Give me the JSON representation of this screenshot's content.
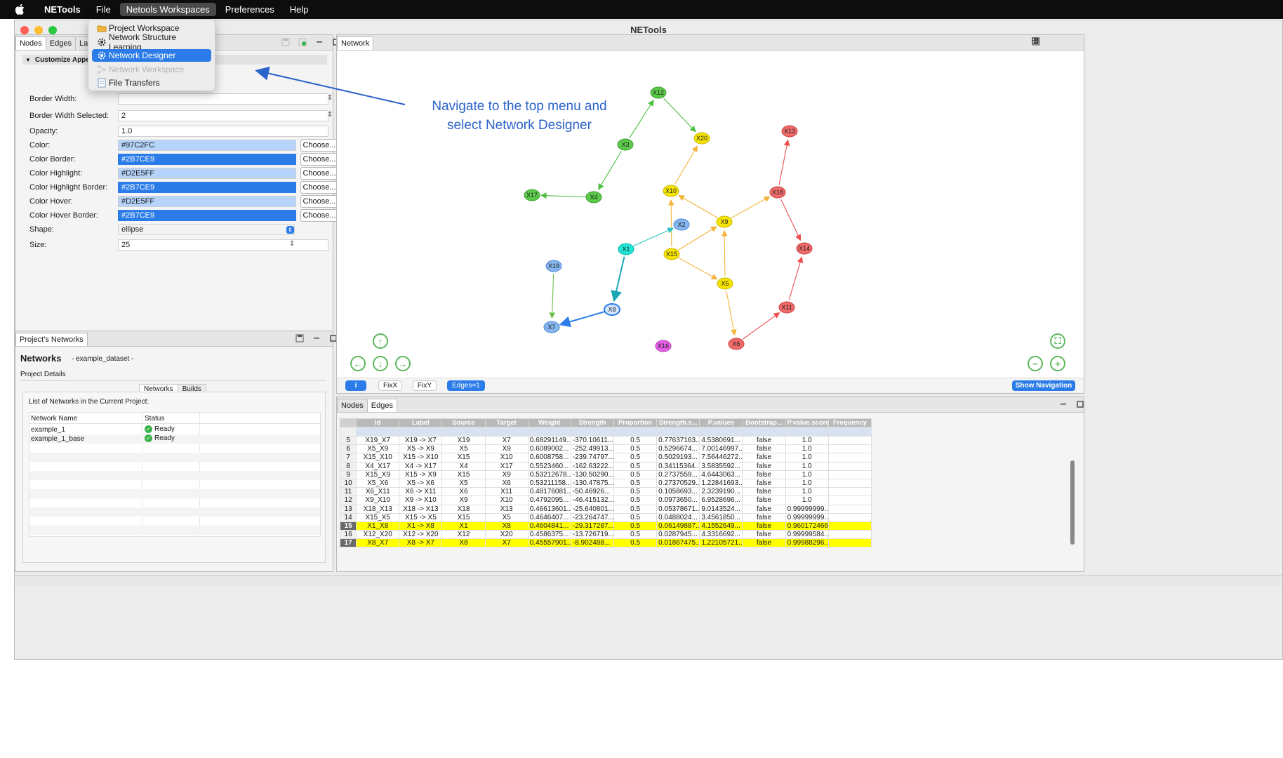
{
  "menubar": {
    "app": "NETools",
    "items": [
      "File",
      "Netools Workspaces",
      "Preferences",
      "Help"
    ]
  },
  "window": {
    "title": "NETools"
  },
  "left_tabs": [
    "Nodes",
    "Edges",
    "Layout"
  ],
  "customize": {
    "header": "Customize Appea",
    "fields": [
      {
        "label": "Border Width:",
        "value": ""
      },
      {
        "label": "Border Width Selected:",
        "value": "2"
      },
      {
        "label": "Opacity:",
        "value": "1.0"
      },
      {
        "label": "Color:",
        "value": "#97C2FC"
      },
      {
        "label": "Color Border:",
        "value": "#2B7CE9"
      },
      {
        "label": "Color Highlight:",
        "value": "#D2E5FF"
      },
      {
        "label": "Color Highlight Border:",
        "value": "#2B7CE9"
      },
      {
        "label": "Color Hover:",
        "value": "#D2E5FF"
      },
      {
        "label": "Color Hover Border:",
        "value": "#2B7CE9"
      },
      {
        "label": "Shape:",
        "value": "ellipse"
      },
      {
        "label": "Size:",
        "value": "25"
      }
    ],
    "choose_label": "Choose..."
  },
  "dropdown": {
    "items": [
      {
        "label": "Project Workspace",
        "icon": "folder-icon",
        "state": "normal"
      },
      {
        "label": "Network Structure Learning",
        "icon": "gear-icon",
        "state": "normal"
      },
      {
        "label": "Network Designer",
        "icon": "gear-icon",
        "state": "highlighted"
      },
      {
        "label": "Network Workspace",
        "icon": "network-icon",
        "state": "disabled"
      },
      {
        "label": "File Transfers",
        "icon": "file-icon",
        "state": "normal"
      }
    ]
  },
  "annotation": {
    "line1": "Navigate to the top menu and",
    "line2": "select Network Designer"
  },
  "project": {
    "tab": "Project's Networks",
    "title": "Networks",
    "dataset": "- example_dataset -",
    "details": "Project Details",
    "subtabs": [
      "Networks",
      "Builds"
    ],
    "list_caption": "List of Networks in the Current Project:",
    "col_name": "Network Name",
    "col_status": "Status",
    "rows": [
      {
        "name": "example_1",
        "status": "Ready"
      },
      {
        "name": "example_1_base",
        "status": "Ready"
      }
    ]
  },
  "network_panel": {
    "tab": "Network"
  },
  "graph": {
    "nodes": [
      {
        "id": "X12",
        "color": "#5cc94b"
      },
      {
        "id": "X20",
        "color": "#f5e400"
      },
      {
        "id": "X3",
        "color": "#5cc94b"
      },
      {
        "id": "X13",
        "color": "#f06a6a"
      },
      {
        "id": "X17",
        "color": "#5cc94b"
      },
      {
        "id": "X4",
        "color": "#5cc94b"
      },
      {
        "id": "X10",
        "color": "#f5e400"
      },
      {
        "id": "X18",
        "color": "#f06a6a"
      },
      {
        "id": "X2",
        "color": "#86b6ef"
      },
      {
        "id": "X9",
        "color": "#f5e400"
      },
      {
        "id": "X1",
        "color": "#1fe6d6"
      },
      {
        "id": "X15",
        "color": "#f5e400"
      },
      {
        "id": "X14",
        "color": "#f06a6a"
      },
      {
        "id": "X19",
        "color": "#86b6ef"
      },
      {
        "id": "X5",
        "color": "#f5e400"
      },
      {
        "id": "X8",
        "color": "#d2e5ff"
      },
      {
        "id": "X11",
        "color": "#f06a6a"
      },
      {
        "id": "X7",
        "color": "#86b6ef"
      },
      {
        "id": "X16",
        "color": "#e65de6"
      },
      {
        "id": "X6",
        "color": "#f06a6a"
      }
    ]
  },
  "graph_toolbar": {
    "info": "i",
    "fixx": "FixX",
    "fixy": "FixY",
    "edges_btn": "Edges=1",
    "show_nav": "Show Navigation"
  },
  "bottom_tabs": [
    "Nodes",
    "Edges"
  ],
  "edges_table": {
    "headers": [
      "Id",
      "Label",
      "Source",
      "Target",
      "Weight",
      "Strength",
      "Proportion",
      "Strength.s...",
      "P.values",
      "Bootstrap...",
      "P.value.score",
      "Frequency"
    ],
    "rows": [
      {
        "n": "5",
        "cells": [
          "X19_X7",
          "X19 -> X7",
          "X19",
          "X7",
          "0.68291149...",
          "-370.10611...",
          "0.5",
          "0.77637163...",
          "4.5380691...",
          "false",
          "1.0",
          ""
        ]
      },
      {
        "n": "6",
        "cells": [
          "X5_X9",
          "X5 -> X9",
          "X5",
          "X9",
          "0.6089002...",
          "-252.49913...",
          "0.5",
          "0.5296674...",
          "7.00146997...",
          "false",
          "1.0",
          ""
        ]
      },
      {
        "n": "7",
        "cells": [
          "X15_X10",
          "X15 -> X10",
          "X15",
          "X10",
          "0.6008758...",
          "-239.74797...",
          "0.5",
          "0.5029193...",
          "7.56446272...",
          "false",
          "1.0",
          ""
        ]
      },
      {
        "n": "8",
        "cells": [
          "X4_X17",
          "X4 -> X17",
          "X4",
          "X17",
          "0.5523460...",
          "-162.63222...",
          "0.5",
          "0.34115364...",
          "3.5835592...",
          "false",
          "1.0",
          ""
        ]
      },
      {
        "n": "9",
        "cells": [
          "X15_X9",
          "X15 -> X9",
          "X15",
          "X9",
          "0.53212678...",
          "-130.50290...",
          "0.5",
          "0.2737559...",
          "4.6443063...",
          "false",
          "1.0",
          ""
        ]
      },
      {
        "n": "10",
        "cells": [
          "X5_X6",
          "X5 -> X6",
          "X5",
          "X6",
          "0.53211158...",
          "-130.47875...",
          "0.5",
          "0.27370529...",
          "1.22841693...",
          "false",
          "1.0",
          ""
        ]
      },
      {
        "n": "11",
        "cells": [
          "X6_X11",
          "X6 -> X11",
          "X6",
          "X11",
          "0.48176081...",
          "-50.46926...",
          "0.5",
          "0.1058693...",
          "2.3239190...",
          "false",
          "1.0",
          ""
        ]
      },
      {
        "n": "12",
        "cells": [
          "X9_X10",
          "X9 -> X10",
          "X9",
          "X10",
          "0.4792095...",
          "-46.415132...",
          "0.5",
          "0.0973650...",
          "6.9528696...",
          "false",
          "1.0",
          ""
        ]
      },
      {
        "n": "13",
        "cells": [
          "X18_X13",
          "X18 -> X13",
          "X18",
          "X13",
          "0.46613601...",
          "-25.640801...",
          "0.5",
          "0.05378671...",
          "9.0143524...",
          "false",
          "0.99999999...",
          ""
        ]
      },
      {
        "n": "14",
        "cells": [
          "X15_X5",
          "X15 -> X5",
          "X15",
          "X5",
          "0.4646407...",
          "-23.264747...",
          "0.5",
          "0.0488024...",
          "3.4561850...",
          "false",
          "0.99999999...",
          ""
        ]
      },
      {
        "n": "15",
        "cells": [
          "X1_X8",
          "X1 -> X8",
          "X1",
          "X8",
          "0.4604841...",
          "-29.317287...",
          "0.5",
          "0.06149887...",
          "4.1552649...",
          "false",
          "0.960172466...",
          ""
        ],
        "hl": true
      },
      {
        "n": "16",
        "cells": [
          "X12_X20",
          "X12 -> X20",
          "X12",
          "X20",
          "0.4586375...",
          "-13.726719...",
          "0.5",
          "0.0287945...",
          "4.3316692...",
          "false",
          "0.99999584...",
          ""
        ]
      },
      {
        "n": "17",
        "cells": [
          "X8_X7",
          "X8 -> X7",
          "X8",
          "X7",
          "0.45557901...",
          "-8.902488...",
          "0.5",
          "0.01867475...",
          "1.22105721...",
          "false",
          "0.99988296...",
          ""
        ],
        "hl": true
      }
    ]
  },
  "colors": {
    "accent": "#2b7ce9",
    "annotation": "#2b63c9",
    "highlight_row": "#ffff00"
  }
}
